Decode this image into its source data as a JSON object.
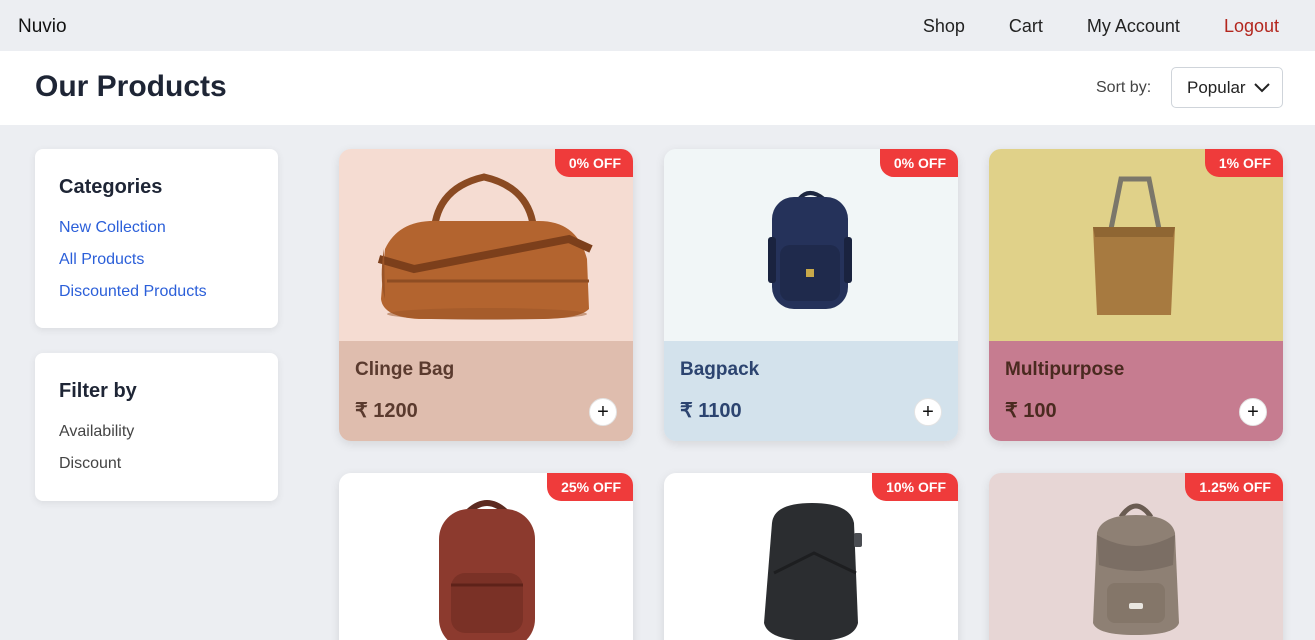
{
  "app": {
    "brand": "Nuvio"
  },
  "nav": {
    "items": [
      "Shop",
      "Cart",
      "My Account",
      "Logout"
    ]
  },
  "header": {
    "title": "Our Products",
    "sort_label": "Sort by:",
    "sort_value": "Popular"
  },
  "sidebar": {
    "categories_title": "Categories",
    "categories": [
      "New Collection",
      "All Products",
      "Discounted Products"
    ],
    "filter_title": "Filter by",
    "filters": [
      "Availability",
      "Discount"
    ]
  },
  "currency_symbol": "₹",
  "products": [
    {
      "name": "Clinge Bag",
      "price": "₹ 1200",
      "discount": "0% OFF",
      "image_bg": "#f5dcd2",
      "info_bg": "#dfbdae",
      "name_color": "#5a3a2e",
      "icon": "duffel-bag-icon"
    },
    {
      "name": "Bagpack",
      "price": "₹ 1100",
      "discount": "0% OFF",
      "image_bg": "#f1f6f7",
      "info_bg": "#d3e2ec",
      "name_color": "#2c4470",
      "icon": "backpack-icon"
    },
    {
      "name": "Multipurpose",
      "price": "₹ 100",
      "discount": "1% OFF",
      "image_bg": "#e0d189",
      "info_bg": "#c67c90",
      "name_color": "#4a2a20",
      "icon": "tote-bag-icon"
    },
    {
      "name": "",
      "price": "",
      "discount": "25% OFF",
      "image_bg": "#ffffff",
      "info_bg": "#ffffff",
      "name_color": "#222",
      "icon": "leather-backpack-icon"
    },
    {
      "name": "",
      "price": "",
      "discount": "10% OFF",
      "image_bg": "#ffffff",
      "info_bg": "#ffffff",
      "name_color": "#222",
      "icon": "anti-theft-backpack-icon"
    },
    {
      "name": "",
      "price": "",
      "discount": "1.25% OFF",
      "image_bg": "#e7d6d5",
      "info_bg": "#e7d6d5",
      "name_color": "#222",
      "icon": "mini-backpack-icon"
    }
  ],
  "add_label": "+",
  "colors": {
    "accent": "#ef3b3b",
    "link": "#2b5fd9",
    "logout": "#b3261e"
  }
}
